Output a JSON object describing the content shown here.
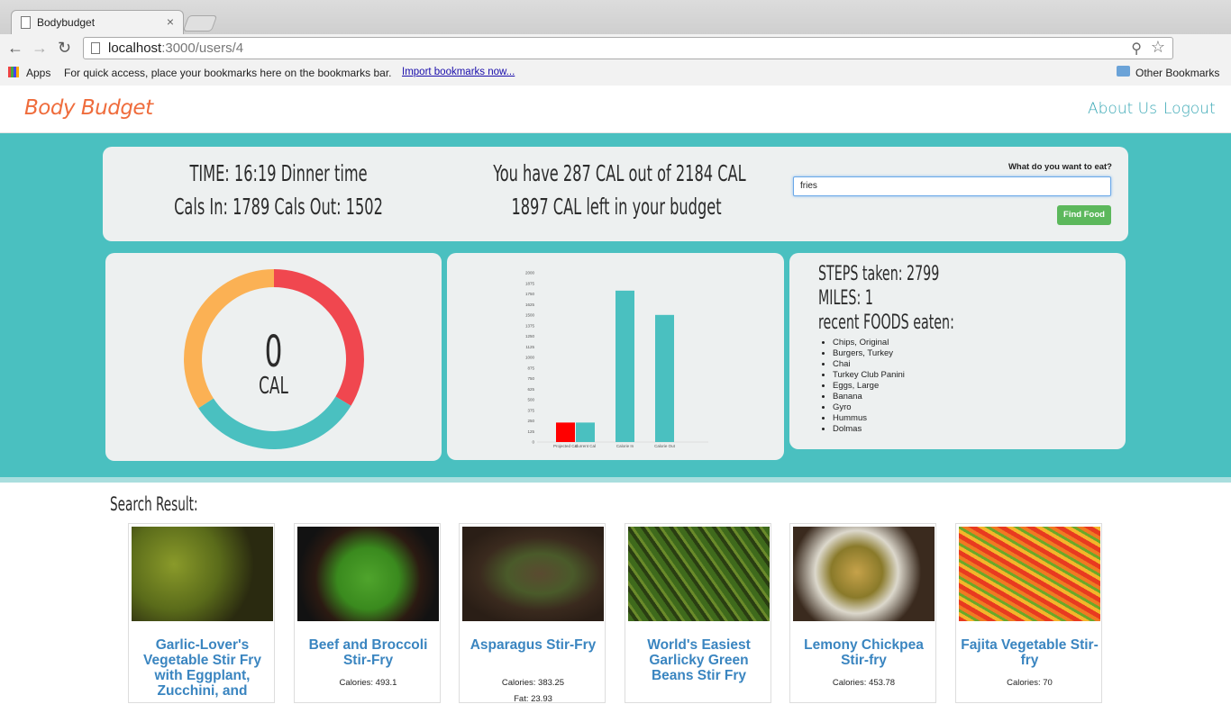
{
  "browser": {
    "tab_title": "Bodybudget",
    "url_host": "localhost",
    "url_rest": ":3000/users/4",
    "bookmarks": {
      "apps": "Apps",
      "hint": "For quick access, place your bookmarks here on the bookmarks bar.",
      "import": "Import bookmarks now...",
      "other": "Other Bookmarks"
    }
  },
  "nav": {
    "brand": "Body Budget",
    "about": "About Us",
    "logout": "Logout"
  },
  "summary": {
    "time_line": "TIME: 16:19 Dinner time",
    "cals_line": "Cals In: 1789 Cals Out: 1502",
    "have_line": "You have 287 CAL out of 2184 CAL",
    "left_line": "1897 CAL left in your budget"
  },
  "search": {
    "label": "What do you want to eat?",
    "value": "fries",
    "button": "Find Food"
  },
  "donut": {
    "value": "0",
    "unit": "CAL",
    "colors": {
      "red": "#f0474f",
      "teal": "#4ac0c0",
      "orange": "#fbb154"
    }
  },
  "chart_data": {
    "type": "bar",
    "categories": [
      "Projected Cal",
      "Current Cal",
      "Calorie In",
      "Calorie Out"
    ],
    "values": [
      230,
      230,
      1789,
      1502
    ],
    "colors": [
      "#ff0000",
      "#4ac0c0",
      "#4ac0c0",
      "#4ac0c0"
    ],
    "ylim": [
      0,
      2000
    ],
    "yticks": [
      "0",
      "125",
      "250",
      "375",
      "500",
      "625",
      "750",
      "875",
      "1000",
      "1125",
      "1250",
      "1375",
      "1500",
      "1625",
      "1750",
      "1875",
      "2000"
    ]
  },
  "activity": {
    "steps": "STEPS taken: 2799",
    "miles": "MILES: 1",
    "recent": "recent FOODS eaten:",
    "foods": [
      "Chips, Original",
      "Burgers, Turkey",
      "Chai",
      "Turkey Club Panini",
      "Eggs, Large",
      "Banana",
      "Gyro",
      "Hummus",
      "Dolmas"
    ]
  },
  "results": {
    "title": "Search Result:",
    "items": [
      {
        "name": "Garlic-Lover's Vegetable Stir Fry with Eggplant, Zucchini, and",
        "stats": []
      },
      {
        "name": "Beef and Broccoli Stir-Fry",
        "stats": [
          "Calories: 493.1"
        ]
      },
      {
        "name": "Asparagus Stir-Fry",
        "stats": [
          "Calories: 383.25",
          "Fat: 23.93"
        ]
      },
      {
        "name": "World's Easiest Garlicky Green Beans Stir Fry",
        "stats": []
      },
      {
        "name": "Lemony Chickpea Stir-fry",
        "stats": [
          "Calories: 453.78"
        ]
      },
      {
        "name": "Fajita Vegetable Stir-fry",
        "stats": [
          "Calories: 70"
        ]
      }
    ]
  }
}
